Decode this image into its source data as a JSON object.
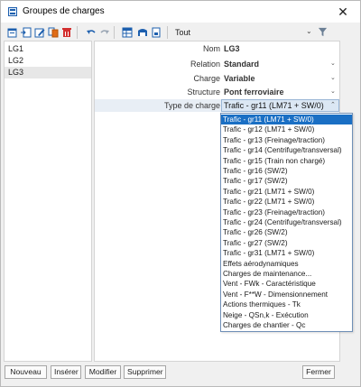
{
  "window": {
    "title": "Groupes de charges"
  },
  "toolbar": {
    "filter_value": "Tout",
    "buttons": [
      "new-icon",
      "insert-icon",
      "edit-icon",
      "copy-icon",
      "delete-icon",
      "undo-icon",
      "redo-icon",
      "table-icon",
      "save-icon",
      "load-icon"
    ],
    "filter_icon": "funnel-icon"
  },
  "groups": [
    {
      "label": "LG1",
      "selected": false
    },
    {
      "label": "LG2",
      "selected": false
    },
    {
      "label": "LG3",
      "selected": true
    }
  ],
  "properties": {
    "name_label": "Nom",
    "name_value": "LG3",
    "relation_label": "Relation",
    "relation_value": "Standard",
    "load_label": "Charge",
    "load_value": "Variable",
    "structure_label": "Structure",
    "structure_value": "Pont ferroviaire",
    "load_type_label": "Type de charge",
    "load_type_value": "Trafic - gr11 (LM71 + SW/0)"
  },
  "dropdown": {
    "options": [
      "Trafic - gr11 (LM71 + SW/0)",
      "Trafic - gr12 (LM71 + SW/0)",
      "Trafic - gr13 (Freinage/traction)",
      "Trafic - gr14 (Centrifuge/transversal)",
      "Trafic - gr15 (Train non chargé)",
      "Trafic - gr16 (SW/2)",
      "Trafic - gr17 (SW/2)",
      "Trafic - gr21 (LM71 + SW/0)",
      "Trafic - gr22 (LM71 + SW/0)",
      "Trafic - gr23 (Freinage/traction)",
      "Trafic - gr24 (Centrifuge/transversal)",
      "Trafic - gr26 (SW/2)",
      "Trafic - gr27 (SW/2)",
      "Trafic - gr31 (LM71 + SW/0)",
      "Effets aérodynamiques",
      "Charges de maintenance...",
      "Vent - FWk - Caractéristique",
      "Vent - F**W - Dimensionnement",
      "Actions thermiques - Tk",
      "Neige - QSn,k - Exécution",
      "Charges de chantier - Qc"
    ],
    "selected_index": 0
  },
  "footer": {
    "new_label": "Nouveau",
    "insert_label": "Insérer",
    "edit_label": "Modifier",
    "delete_label": "Supprimer",
    "close_label": "Fermer"
  }
}
